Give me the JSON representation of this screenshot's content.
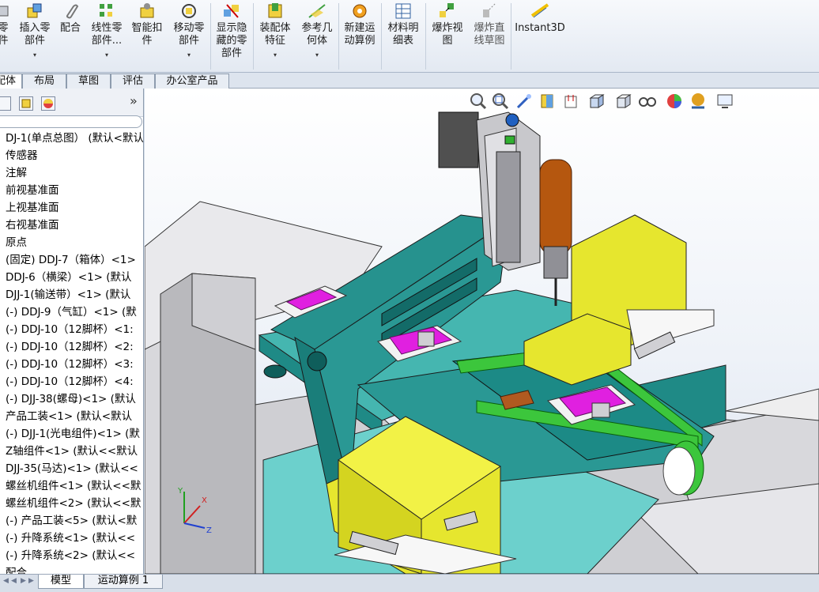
{
  "ribbon": {
    "items": [
      {
        "label": "零\n件",
        "dropdown": false
      },
      {
        "label": "插入零\n部件",
        "dropdown": true
      },
      {
        "label": "配合",
        "dropdown": false
      },
      {
        "label": "线性零\n部件...",
        "dropdown": true
      },
      {
        "label": "智能扣\n件",
        "dropdown": false
      },
      {
        "label": "移动零\n部件",
        "dropdown": true
      },
      {
        "label": "显示隐\n藏的零\n部件",
        "dropdown": false
      },
      {
        "label": "装配体\n特征",
        "dropdown": true
      },
      {
        "label": "参考几\n何体",
        "dropdown": true
      },
      {
        "label": "新建运\n动算例",
        "dropdown": false
      },
      {
        "label": "材料明\n细表",
        "dropdown": false
      },
      {
        "label": "爆炸视\n图",
        "dropdown": false
      },
      {
        "label": "爆炸直\n线草图",
        "dropdown": false
      },
      {
        "label": "Instant3D",
        "dropdown": false
      }
    ],
    "dropdown_glyph": "▾"
  },
  "tabs": [
    "配体",
    "布局",
    "草图",
    "评估",
    "办公室产品"
  ],
  "tree": {
    "collapse_glyph": "»",
    "items": [
      "DJ-1(单点总图） (默认<默认",
      "传感器",
      "注解",
      "前视基准面",
      "上视基准面",
      "右视基准面",
      "原点",
      "(固定) DDJ-7（箱体）<1>",
      "DDJ-6（横梁）<1> (默认",
      "DJJ-1(输送带）<1> (默认",
      "(-) DDJ-9（气缸）<1> (默",
      "(-) DDJ-10（12脚杯）<1:",
      "(-) DDJ-10（12脚杯）<2:",
      "(-) DDJ-10（12脚杯）<3:",
      "(-) DDJ-10（12脚杯）<4:",
      "(-) DJJ-38(螺母)<1> (默认",
      "产品工装<1> (默认<默认",
      "(-) DJJ-1(光电组件)<1> (默",
      "Z轴组件<1> (默认<<默认",
      "DJJ-35(马达)<1> (默认<<",
      "螺丝机组件<1> (默认<<默",
      "螺丝机组件<2> (默认<<默",
      "(-) 产品工装<5> (默认<默",
      "(-) 升降系统<1> (默认<<",
      "(-) 升降系统<2> (默认<<",
      "配合"
    ]
  },
  "viewport": {
    "triad": {
      "x": "X",
      "y": "Y",
      "z": "Z"
    },
    "hud_icons": [
      "zoom-to-fit-icon",
      "zoom-area-icon",
      "previous-view-icon",
      "section-view-icon",
      "dynamic-annotation-icon",
      "view-orientation-icon",
      "display-style-icon",
      "hide-show-items-icon",
      "edit-appearance-icon",
      "apply-scene-icon",
      "view-settings-icon"
    ]
  },
  "bottom_tabs": [
    "模型",
    "运动算例 1"
  ],
  "colors": {
    "teal": "#1c8a8a",
    "yellow": "#e6e62e",
    "green": "#3cc63c",
    "magenta": "#e020e0",
    "orange": "#c06010",
    "gray": "#b8b8bc"
  }
}
